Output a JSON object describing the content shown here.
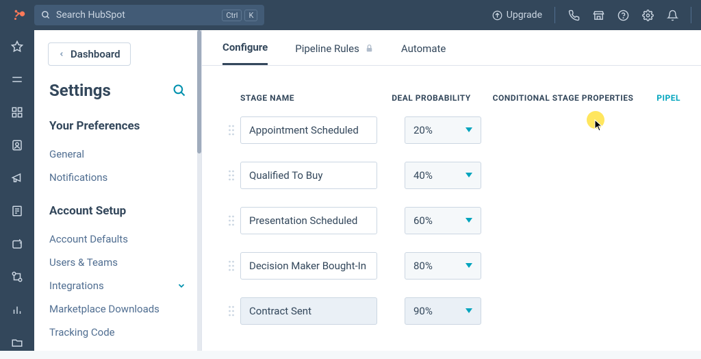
{
  "topbar": {
    "search_placeholder": "Search HubSpot",
    "kbd_ctrl": "Ctrl",
    "kbd_k": "K",
    "upgrade_label": "Upgrade"
  },
  "sidebar": {
    "dashboard_label": "Dashboard",
    "title": "Settings",
    "groups": [
      {
        "heading": "Your Preferences",
        "items": [
          {
            "label": "General",
            "expandable": false
          },
          {
            "label": "Notifications",
            "expandable": false
          }
        ]
      },
      {
        "heading": "Account Setup",
        "items": [
          {
            "label": "Account Defaults",
            "expandable": false
          },
          {
            "label": "Users & Teams",
            "expandable": false
          },
          {
            "label": "Integrations",
            "expandable": true
          },
          {
            "label": "Marketplace Downloads",
            "expandable": false
          },
          {
            "label": "Tracking Code",
            "expandable": false
          }
        ]
      }
    ]
  },
  "tabs": {
    "configure": "Configure",
    "pipeline_rules": "Pipeline Rules",
    "automate": "Automate"
  },
  "columns": {
    "stage_name": "STAGE NAME",
    "deal_probability": "DEAL PROBABILITY",
    "conditional": "CONDITIONAL STAGE PROPERTIES",
    "pipeline": "PIPEL"
  },
  "stages": [
    {
      "name": "Appointment Scheduled",
      "probability": "20%"
    },
    {
      "name": "Qualified To Buy",
      "probability": "40%"
    },
    {
      "name": "Presentation Scheduled",
      "probability": "60%"
    },
    {
      "name": "Decision Maker Bought-In",
      "probability": "80%"
    },
    {
      "name": "Contract Sent",
      "probability": "90%",
      "highlighted": true
    }
  ]
}
